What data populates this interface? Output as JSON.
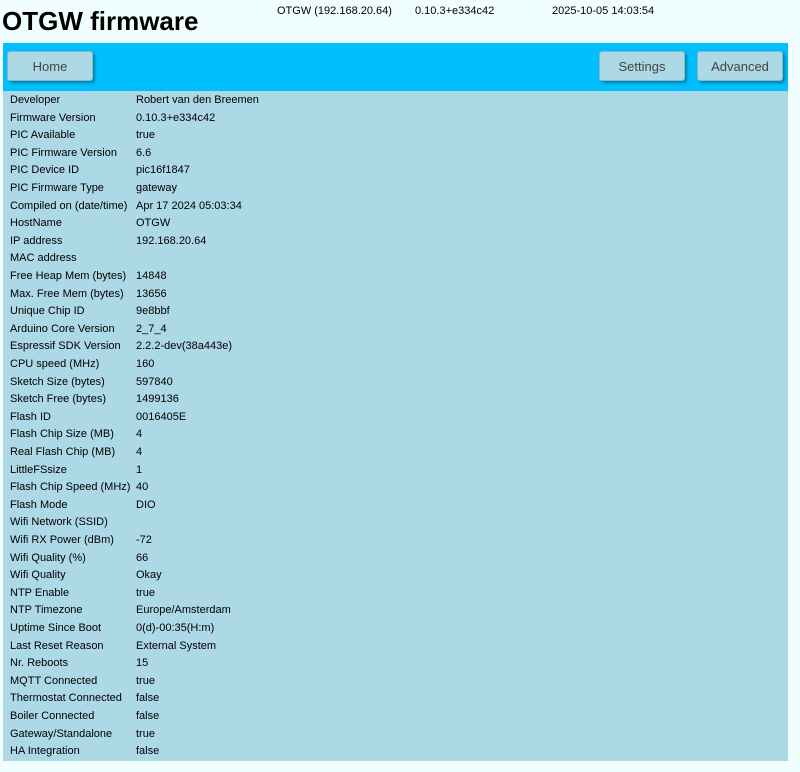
{
  "app": {
    "title": "OTGW firmware",
    "device": "OTGW (192.168.20.64)",
    "version": "0.10.3+e334c42",
    "datetime": "2025-10-05 14:03:54"
  },
  "nav": {
    "home": "Home",
    "settings": "Settings",
    "advanced": "Advanced"
  },
  "colors": {
    "navbar": "#00bfff",
    "content": "#add8e6",
    "page": "#f0fffe"
  },
  "info": [
    {
      "label": "Developer",
      "value": "Robert van den Breemen"
    },
    {
      "label": "Firmware Version",
      "value": "0.10.3+e334c42"
    },
    {
      "label": "PIC Available",
      "value": "true"
    },
    {
      "label": "PIC Firmware Version",
      "value": "6.6"
    },
    {
      "label": "PIC Device ID",
      "value": "pic16f1847"
    },
    {
      "label": "PIC Firmware Type",
      "value": "gateway"
    },
    {
      "label": "Compiled on (date/time)",
      "value": "Apr 17 2024 05:03:34"
    },
    {
      "label": "HostName",
      "value": "OTGW"
    },
    {
      "label": "IP address",
      "value": "192.168.20.64"
    },
    {
      "label": "MAC address",
      "value": ""
    },
    {
      "label": "Free Heap Mem (bytes)",
      "value": "14848"
    },
    {
      "label": "Max. Free Mem (bytes)",
      "value": "13656"
    },
    {
      "label": "Unique Chip ID",
      "value": "9e8bbf"
    },
    {
      "label": "Arduino Core Version",
      "value": "2_7_4"
    },
    {
      "label": "Espressif SDK Version",
      "value": "2.2.2-dev(38a443e)"
    },
    {
      "label": "CPU speed (MHz)",
      "value": "160"
    },
    {
      "label": "Sketch Size (bytes)",
      "value": "597840"
    },
    {
      "label": "Sketch Free (bytes)",
      "value": "1499136"
    },
    {
      "label": "Flash ID",
      "value": "0016405E"
    },
    {
      "label": "Flash Chip Size (MB)",
      "value": "4"
    },
    {
      "label": "Real Flash Chip (MB)",
      "value": "4"
    },
    {
      "label": "LittleFSsize",
      "value": "1"
    },
    {
      "label": "Flash Chip Speed (MHz)",
      "value": "40"
    },
    {
      "label": "Flash Mode",
      "value": "DIO"
    },
    {
      "label": "Wifi Network (SSID)",
      "value": ""
    },
    {
      "label": "Wifi RX Power (dBm)",
      "value": "-72"
    },
    {
      "label": "Wifi Quality (%)",
      "value": "66"
    },
    {
      "label": "Wifi Quality",
      "value": "Okay"
    },
    {
      "label": "NTP Enable",
      "value": "true"
    },
    {
      "label": "NTP Timezone",
      "value": "Europe/Amsterdam"
    },
    {
      "label": "Uptime Since Boot",
      "value": "0(d)-00:35(H:m)"
    },
    {
      "label": "Last Reset Reason",
      "value": "External System"
    },
    {
      "label": "Nr. Reboots",
      "value": "15"
    },
    {
      "label": "MQTT Connected",
      "value": "true"
    },
    {
      "label": "Thermostat Connected",
      "value": "false"
    },
    {
      "label": "Boiler Connected",
      "value": "false"
    },
    {
      "label": "Gateway/Standalone",
      "value": "true"
    },
    {
      "label": "HA Integration",
      "value": "false"
    }
  ]
}
